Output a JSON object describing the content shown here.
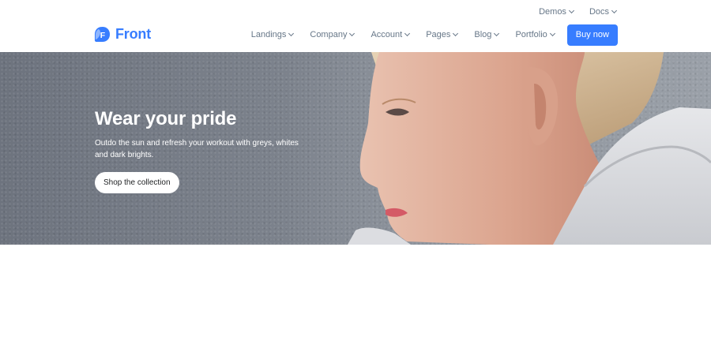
{
  "topbar": {
    "links": [
      {
        "label": "Demos",
        "icon": "chevron-down-icon"
      },
      {
        "label": "Docs",
        "icon": "chevron-down-icon"
      }
    ]
  },
  "header": {
    "logo": {
      "text": "Front",
      "mark_letter": "F"
    },
    "nav": [
      {
        "label": "Landings"
      },
      {
        "label": "Company"
      },
      {
        "label": "Account"
      },
      {
        "label": "Pages"
      },
      {
        "label": "Blog"
      },
      {
        "label": "Portfolio"
      }
    ],
    "cta_label": "Buy now"
  },
  "hero": {
    "title": "Wear your pride",
    "subtitle": "Outdo the sun and refresh your workout with greys, whites and dark brights.",
    "button_label": "Shop the collection",
    "image": "woman-profile-portrait"
  },
  "colors": {
    "brand": "#377dff",
    "nav_text": "#677788",
    "hero_text": "#ffffff"
  }
}
